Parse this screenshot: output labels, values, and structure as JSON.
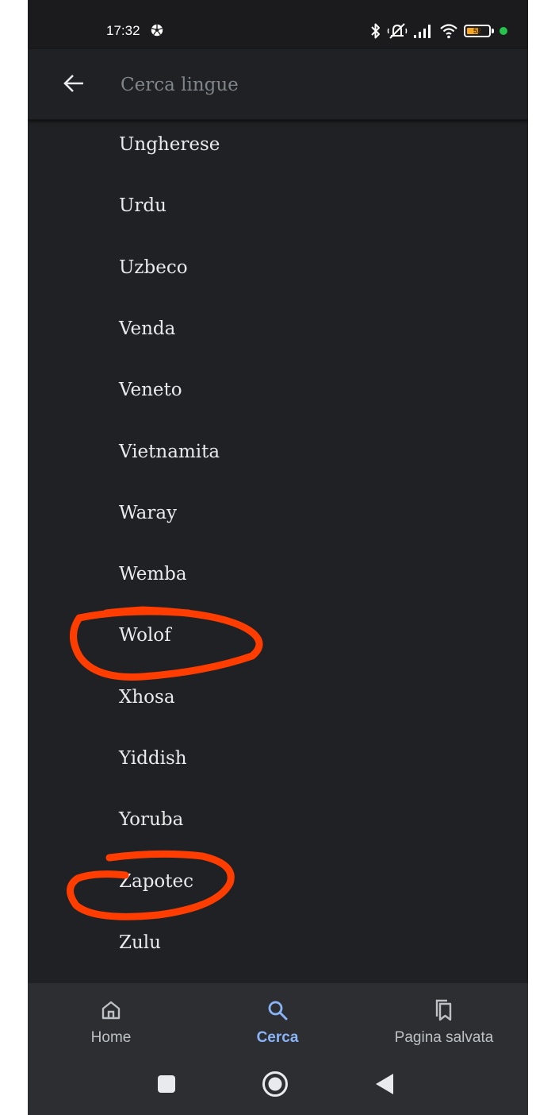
{
  "status_bar": {
    "time": "17:32",
    "battery_level": "52",
    "battery_fraction": 0.52,
    "icons": [
      "soccer-ball-icon",
      "bluetooth-icon",
      "silent-icon",
      "signal-icon",
      "wifi-icon",
      "battery-icon",
      "privacy-dot-icon"
    ],
    "battery_color": "#f5a623",
    "dot_color": "#27c24c"
  },
  "search": {
    "placeholder": "Cerca lingue",
    "value": "",
    "back_icon": "arrow-left-icon"
  },
  "languages": [
    "Ungherese",
    "Urdu",
    "Uzbeco",
    "Venda",
    "Veneto",
    "Vietnamita",
    "Waray",
    "Wemba",
    "Wolof",
    "Xhosa",
    "Yiddish",
    "Yoruba",
    "Zapotec",
    "Zulu"
  ],
  "annotations": {
    "circled_items": [
      "Wolof",
      "Zapotec"
    ],
    "color": "#ff3d00"
  },
  "bottom_nav": {
    "items": [
      {
        "label": "Home",
        "icon": "home-icon",
        "active": false
      },
      {
        "label": "Cerca",
        "icon": "search-icon",
        "active": true
      },
      {
        "label": "Pagina salvata",
        "icon": "bookmarks-icon",
        "active": false
      }
    ],
    "active_color": "#8ab4f8"
  },
  "system_nav": {
    "buttons": [
      "recents-square-icon",
      "home-circle-icon",
      "back-triangle-icon"
    ]
  }
}
